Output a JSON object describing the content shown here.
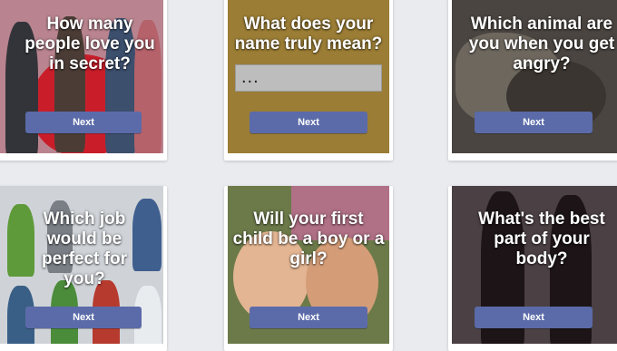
{
  "cards": [
    {
      "question": "How many people love you in secret?",
      "button": "Next"
    },
    {
      "question": "What does your name truly mean?",
      "button": "Next",
      "input_value": "..."
    },
    {
      "question": "Which animal are you when you get angry?",
      "button": "Next"
    },
    {
      "question": "Which job would be perfect for you?",
      "button": "Next"
    },
    {
      "question": "Will your first child be a boy or a girl?",
      "button": "Next"
    },
    {
      "question": "What's the best part of your body?",
      "button": "Next"
    }
  ],
  "colors": {
    "page_bg": "#e9ebee",
    "button": "#5b6ba9",
    "card1_bg": "#b9848f",
    "card2_bg": "#9b7d35",
    "card3_bg": "#4a4540",
    "card4_bg": "#cfd3d8",
    "card5_bg": "#6c7a4a",
    "card6_bg": "#4b4043"
  }
}
